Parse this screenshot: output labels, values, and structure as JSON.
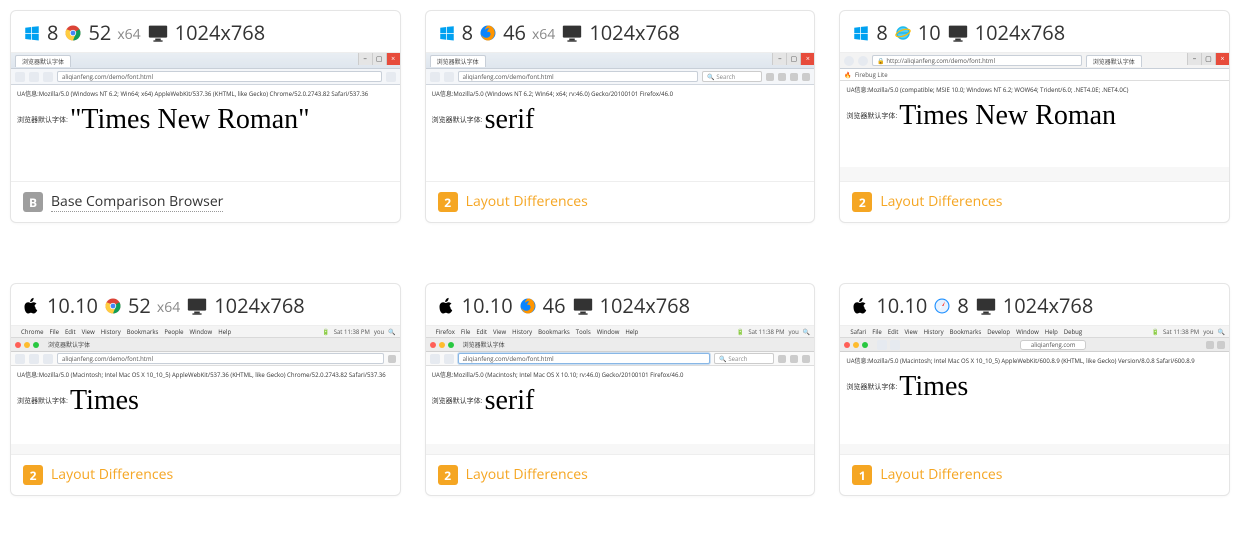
{
  "resolution_label": "1024x768",
  "page_title_cn": "浏览器默认字体",
  "font_label_cn": "浏览器默认字体:",
  "url_demo": "aliqianfeng.com/demo/font.html",
  "footer": {
    "base_label": "Base Comparison Browser",
    "diff_label": "Layout Differences"
  },
  "mac_menu": {
    "items_chrome": [
      "Chrome",
      "File",
      "Edit",
      "View",
      "History",
      "Bookmarks",
      "People",
      "Window",
      "Help"
    ],
    "items_firefox": [
      "Firefox",
      "File",
      "Edit",
      "View",
      "History",
      "Bookmarks",
      "Tools",
      "Window",
      "Help"
    ],
    "items_safari": [
      "Safari",
      "File",
      "Edit",
      "View",
      "History",
      "Bookmarks",
      "Develop",
      "Window",
      "Help",
      "Debug"
    ],
    "clock": "Sat 11:38 PM",
    "user": "you"
  },
  "cards": [
    {
      "os": "windows",
      "os_ver": "8",
      "browser": "chrome",
      "browser_ver": "52",
      "arch": "x64",
      "ua": "UA信息:Mozilla/5.0 (Windows NT 6.2; Win64; x64) AppleWebKit/537.36 (KHTML, like Gecko) Chrome/52.0.2743.82 Safari/537.36",
      "font_text": "\"Times New Roman\"",
      "footer_type": "base",
      "footer_badge": "B"
    },
    {
      "os": "windows",
      "os_ver": "8",
      "browser": "firefox",
      "browser_ver": "46",
      "arch": "x64",
      "ua": "UA信息:Mozilla/5.0 (Windows NT 6.2; Win64; x64; rv:46.0) Gecko/20100101 Firefox/46.0",
      "font_text": "serif",
      "footer_type": "diff",
      "footer_badge": "2"
    },
    {
      "os": "windows",
      "os_ver": "8",
      "browser": "ie",
      "browser_ver": "10",
      "arch": "",
      "ua": "UA信息:Mozilla/5.0 (compatible; MSIE 10.0; Windows NT 6.2; WOW64; Trident/6.0; .NET4.0E; .NET4.0C)",
      "font_text": "Times New Roman",
      "footer_type": "diff",
      "footer_badge": "2",
      "firebug": "Firebug Lite"
    },
    {
      "os": "mac",
      "os_ver": "10.10",
      "browser": "chrome",
      "browser_ver": "52",
      "arch": "x64",
      "ua": "UA信息:Mozilla/5.0 (Macintosh; Intel Mac OS X 10_10_5) AppleWebKit/537.36 (KHTML, like Gecko) Chrome/52.0.2743.82 Safari/537.36",
      "font_text": "Times",
      "footer_type": "diff",
      "footer_badge": "2"
    },
    {
      "os": "mac",
      "os_ver": "10.10",
      "browser": "firefox",
      "browser_ver": "46",
      "arch": "",
      "ua": "UA信息:Mozilla/5.0 (Macintosh; Intel Mac OS X 10.10; rv:46.0) Gecko/20100101 Firefox/46.0",
      "font_text": "serif",
      "footer_type": "diff",
      "footer_badge": "2"
    },
    {
      "os": "mac",
      "os_ver": "10.10",
      "browser": "safari",
      "browser_ver": "8",
      "arch": "",
      "ua": "UA信息:Mozilla/5.0 (Macintosh; Intel Mac OS X 10_10_5) AppleWebKit/600.8.9 (KHTML, like Gecko) Version/8.0.8 Safari/600.8.9",
      "font_text": "Times",
      "footer_type": "diff",
      "footer_badge": "1"
    }
  ]
}
